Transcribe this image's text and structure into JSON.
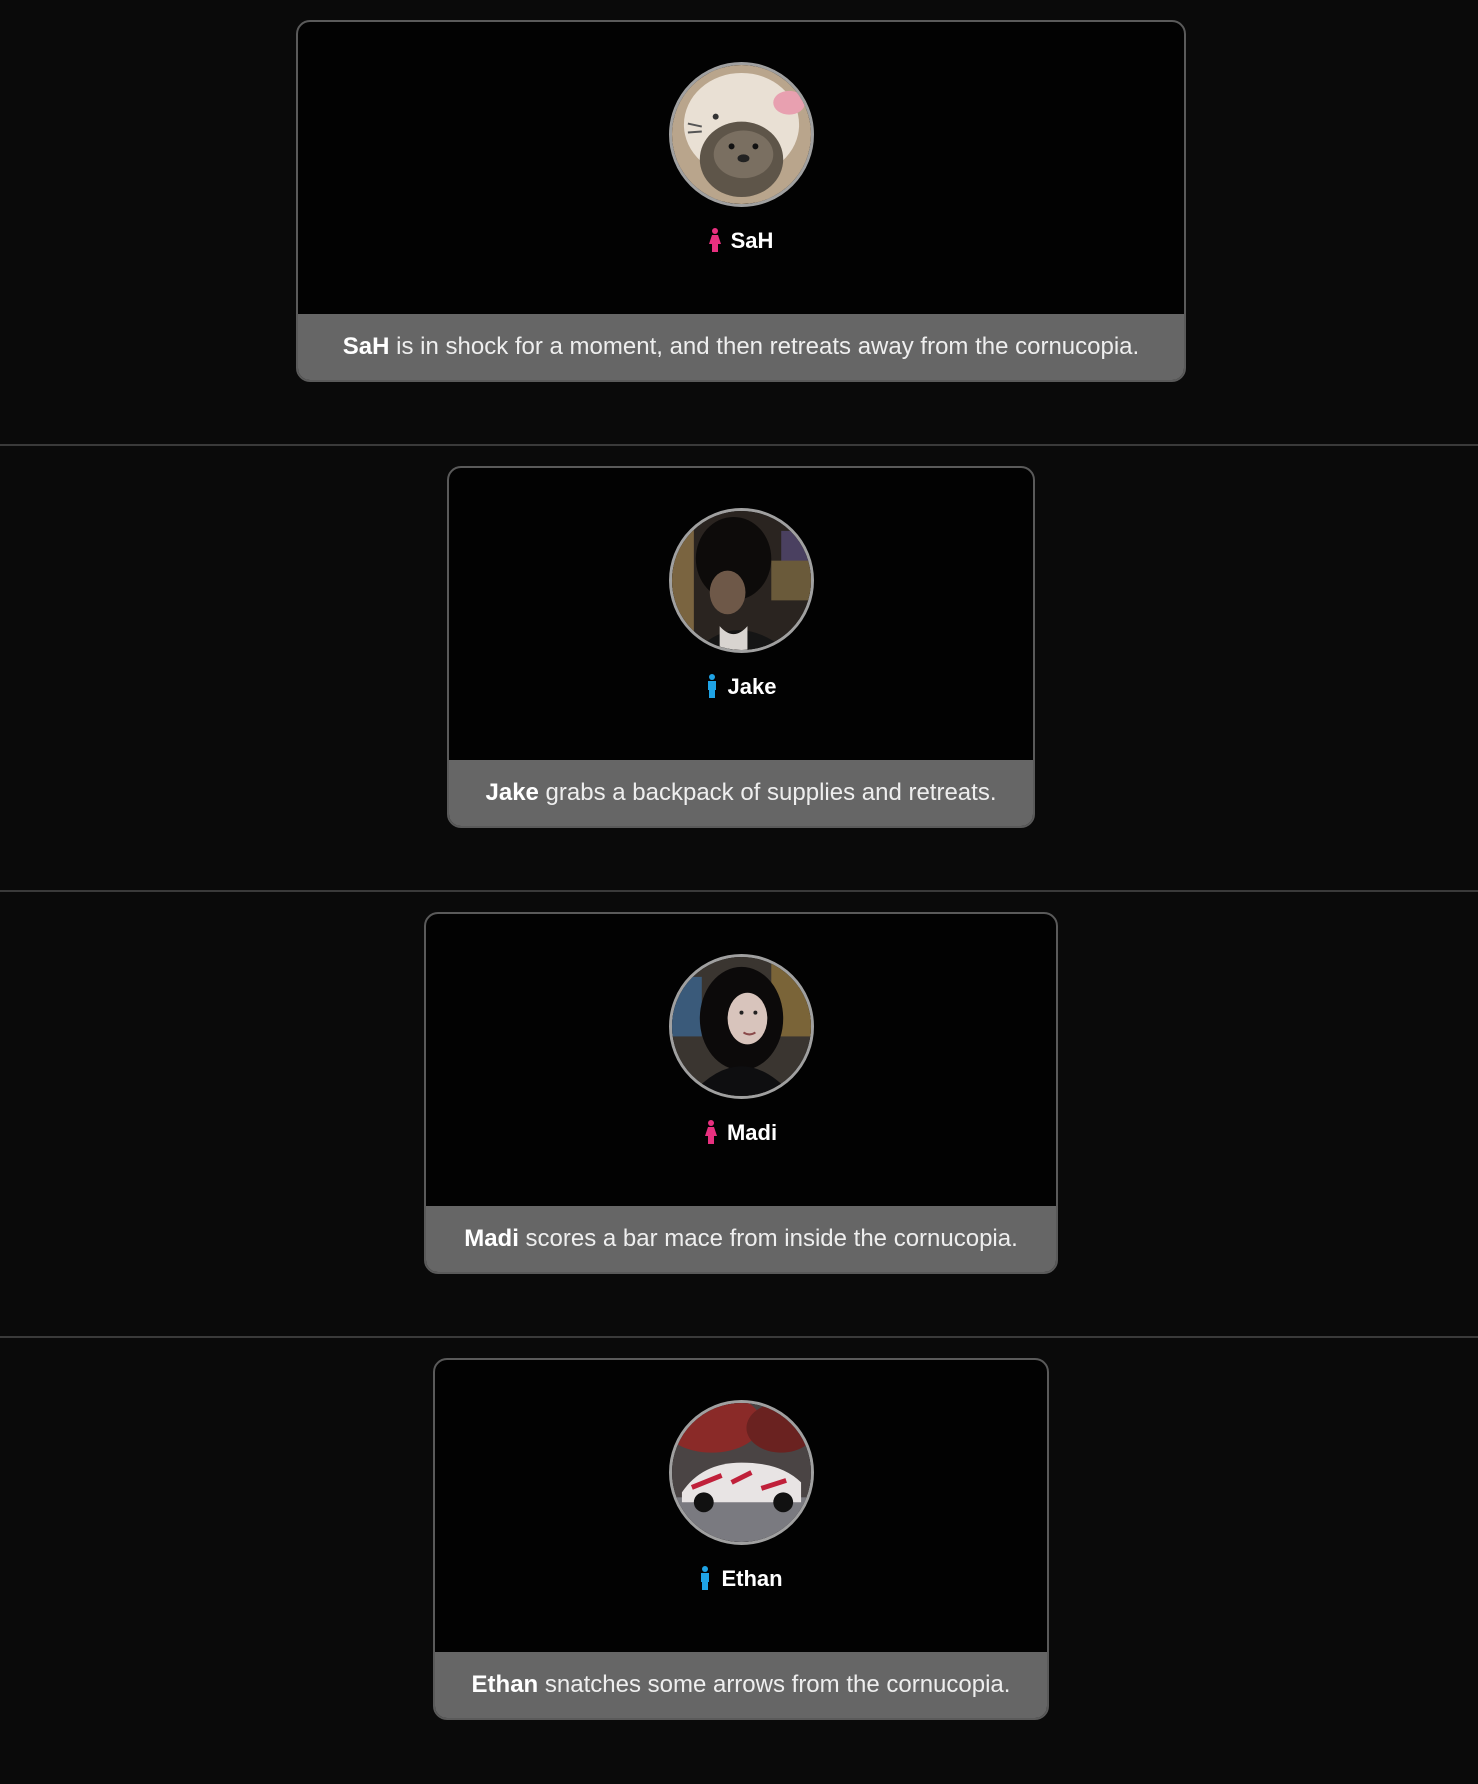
{
  "events": [
    {
      "name": "SaH",
      "gender_icon": "female-icon",
      "gender_color": "#e8307f",
      "avatar": "otter-avatar",
      "action": " is in shock for a moment, and then retreats away from the cornucopia."
    },
    {
      "name": "Jake",
      "gender_icon": "male-icon",
      "gender_color": "#1fa3e5",
      "avatar": "dark-haired-person-avatar",
      "action": " grabs a backpack of supplies and retreats."
    },
    {
      "name": "Madi",
      "gender_icon": "female-icon",
      "gender_color": "#e8307f",
      "avatar": "woman-portrait-avatar",
      "action": " scores a bar mace from inside the cornucopia."
    },
    {
      "name": "Ethan",
      "gender_icon": "male-icon",
      "gender_color": "#1fa3e5",
      "avatar": "red-white-car-avatar",
      "action": " snatches some arrows from the cornucopia."
    }
  ]
}
